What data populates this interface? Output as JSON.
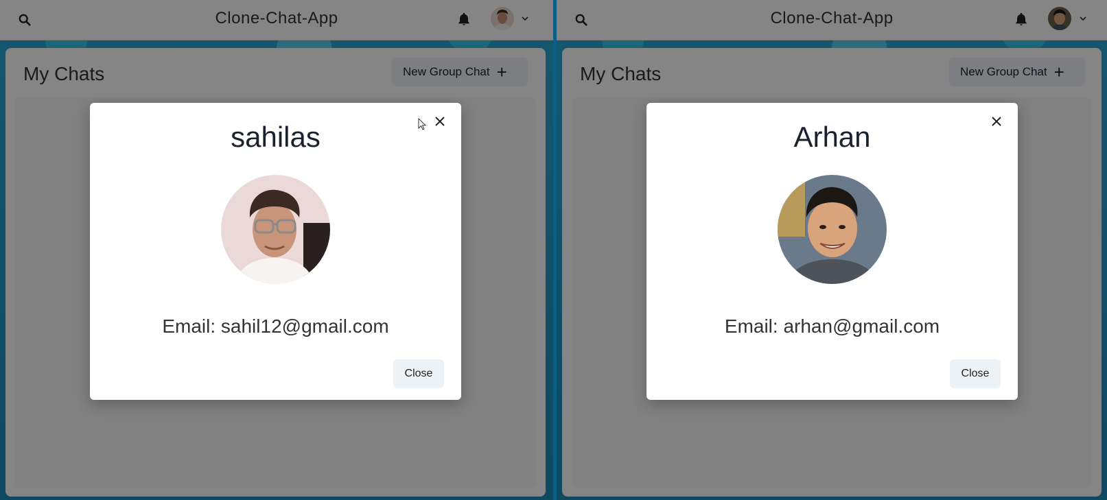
{
  "app": {
    "title": "Clone-Chat-App"
  },
  "colors": {
    "bg_blue": "#2aa9d6",
    "button_bg": "#edf2f7",
    "overlay": "rgba(0,0,0,0.48)"
  },
  "icons": [
    "search-icon",
    "bell-icon",
    "chevron-down-icon",
    "plus-icon",
    "close-icon",
    "cursor-icon"
  ],
  "panels": [
    {
      "header": {
        "title": "Clone-Chat-App"
      },
      "sidebar": {
        "title": "My Chats",
        "new_group_label": "New Group Chat"
      },
      "modal": {
        "name": "sahilas",
        "email_text": "Email: sahil12@gmail.com",
        "close_label": "Close"
      }
    },
    {
      "header": {
        "title": "Clone-Chat-App"
      },
      "sidebar": {
        "title": "My Chats",
        "new_group_label": "New Group Chat"
      },
      "modal": {
        "name": "Arhan",
        "email_text": "Email: arhan@gmail.com",
        "close_label": "Close"
      }
    }
  ]
}
